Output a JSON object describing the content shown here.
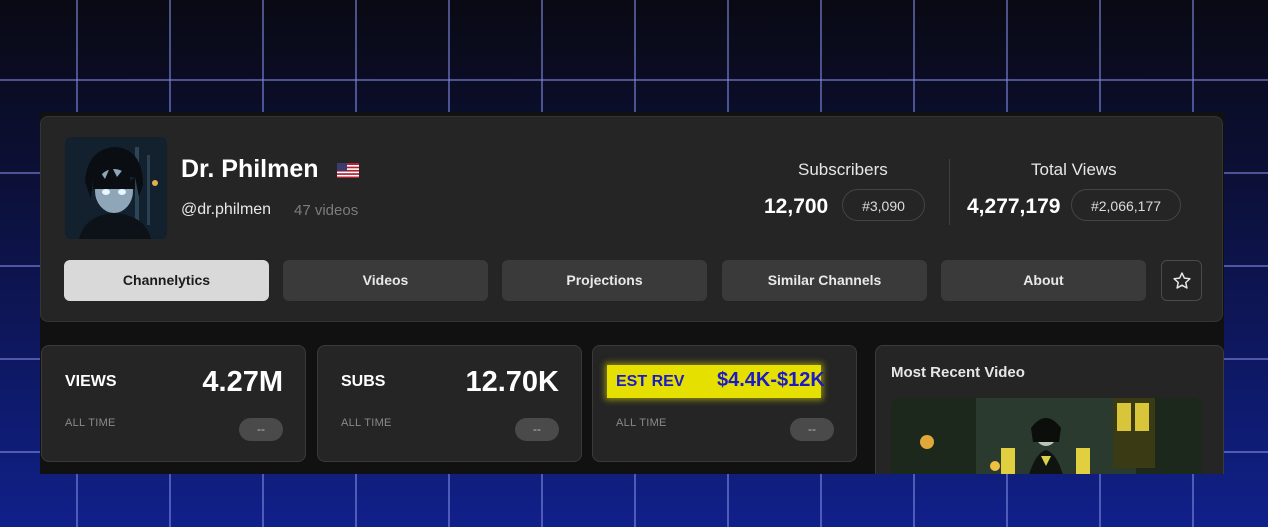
{
  "channel": {
    "name": "Dr. Philmen",
    "handle": "@dr.philmen",
    "video_count": "47 videos",
    "flag_icon": "us-flag-icon"
  },
  "stats": {
    "subscribers_label": "Subscribers",
    "subscribers_value": "12,700",
    "subscribers_rank": "#3,090",
    "views_label": "Total Views",
    "views_value": "4,277,179",
    "views_rank": "#2,066,177"
  },
  "tabs": [
    {
      "label": "Channelytics",
      "active": true
    },
    {
      "label": "Videos",
      "active": false
    },
    {
      "label": "Projections",
      "active": false
    },
    {
      "label": "Similar Channels",
      "active": false
    },
    {
      "label": "About",
      "active": false
    }
  ],
  "favorite_icon": "star-icon",
  "metrics": [
    {
      "title": "VIEWS",
      "value": "4.27M",
      "sub": "ALL TIME",
      "chip": "--"
    },
    {
      "title": "SUBS",
      "value": "12.70K",
      "sub": "ALL TIME",
      "chip": "--"
    },
    {
      "title": "EST REV",
      "value": "$4.4K-$12K",
      "sub": "ALL TIME",
      "chip": "--"
    }
  ],
  "recent_video": {
    "title": "Most Recent Video"
  },
  "colors": {
    "card_bg": "#252525",
    "active_tab": "#d9d9d9",
    "highlight": "#e6e000",
    "highlight_text": "#1a1ac8"
  }
}
